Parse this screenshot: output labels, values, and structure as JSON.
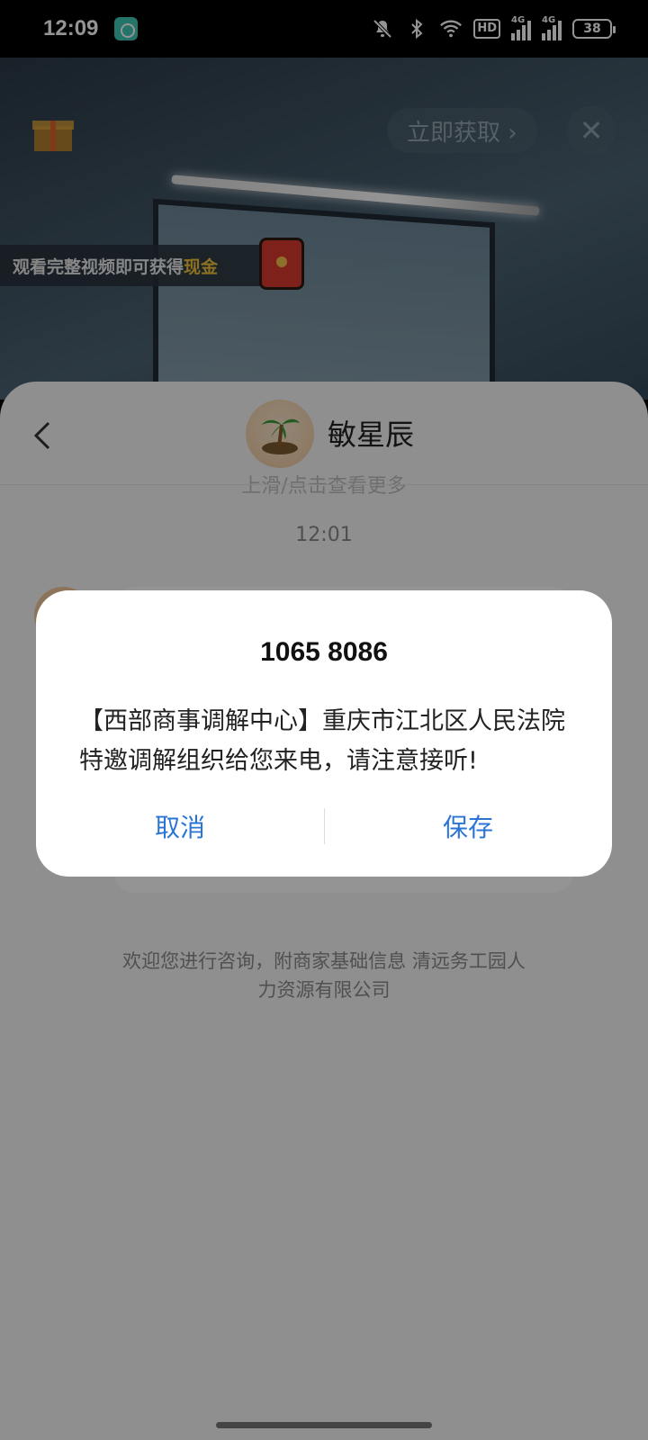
{
  "status_bar": {
    "time": "12:09",
    "icons": [
      "mute-icon",
      "bluetooth-icon",
      "wifi-icon",
      "hd-icon",
      "signal-4g-icon",
      "signal-4g-icon",
      "battery-icon"
    ],
    "hd_label": "HD",
    "network_label": "4G",
    "battery": "38"
  },
  "ad": {
    "get_now_label": "立即获取 ›",
    "close_symbol": "✕",
    "reward_text": "观看完整视频即可获得",
    "reward_highlight": "现金",
    "highlight_color": "#f2c33a"
  },
  "chat": {
    "back_symbol": "‹",
    "contact_name": "敏星辰",
    "hint": "上滑/点击查看更多",
    "time": "12:01",
    "footer_note": "欢迎您进行咨询，附商家基础信息 清远务工园人力资源有限公司"
  },
  "dialog": {
    "title": "1065 8086",
    "body": "【西部商事调解中心】重庆市江北区人民法院特邀调解组织给您来电，请注意接听!",
    "cancel_label": "取消",
    "save_label": "保存",
    "button_color": "#2a74d6"
  }
}
